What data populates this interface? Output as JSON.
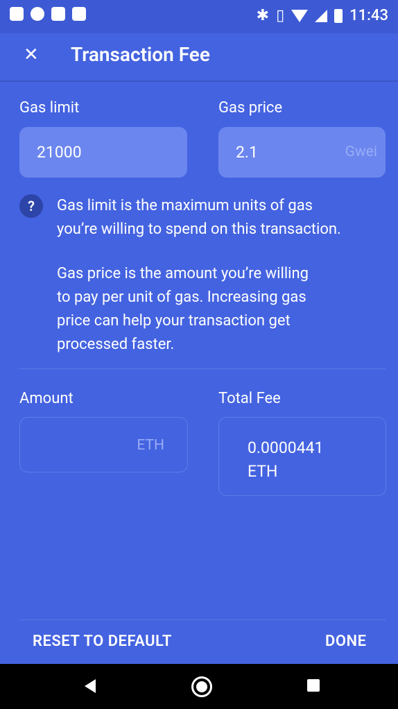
{
  "status_bar": {
    "time": "11:43",
    "left_icons": [
      "notes-icon",
      "hashtag-icon",
      "gmail-icon",
      "image-icon"
    ],
    "right_icons": [
      "bluetooth-icon",
      "vibrate-icon",
      "wifi-icon",
      "signal-icon",
      "battery-icon"
    ]
  },
  "app_bar": {
    "close_glyph": "✕",
    "title": "Transaction Fee"
  },
  "gas_limit": {
    "label": "Gas limit",
    "value": "21000"
  },
  "gas_price": {
    "label": "Gas price",
    "value": "2.1",
    "unit": "Gwei"
  },
  "help": {
    "icon": "?",
    "paragraph1_line1": "Gas limit is the maximum units of gas",
    "paragraph1_line2": "you’re willing to spend on this transaction.",
    "paragraph2_line1": "Gas price is the amount you’re willing",
    "paragraph2_line2": "to pay per unit of gas. Increasing gas",
    "paragraph2_line3": "price can help your transaction get",
    "paragraph2_line4": "processed faster."
  },
  "amount": {
    "label": "Amount",
    "value": "",
    "unit": "ETH"
  },
  "total_fee": {
    "label": "Total Fee",
    "value_line1": "0.0000441",
    "value_line2": "ETH"
  },
  "footer": {
    "reset_label": "RESET TO DEFAULT",
    "done_label": "DONE"
  },
  "colors": {
    "background": "#4463e0",
    "field_fill": "#6b86ee",
    "help_icon_bg": "#2d44a8"
  }
}
